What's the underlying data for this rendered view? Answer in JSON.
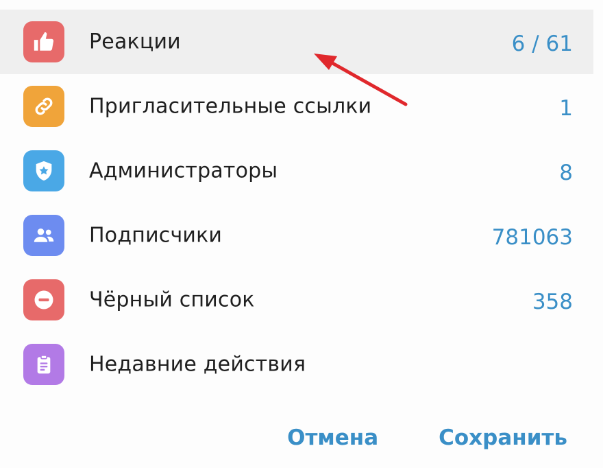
{
  "items": [
    {
      "label": "Реакции",
      "value": "6 / 61",
      "icon": "thumbs-up-icon",
      "color": "#e76a6a",
      "highlight": true
    },
    {
      "label": "Пригласительные ссылки",
      "value": "1",
      "icon": "link-icon",
      "color": "#f0a43a",
      "highlight": false
    },
    {
      "label": "Администраторы",
      "value": "8",
      "icon": "shield-star-icon",
      "color": "#4aa8e6",
      "highlight": false
    },
    {
      "label": "Подписчики",
      "value": "781063",
      "icon": "people-icon",
      "color": "#6d8cf0",
      "highlight": false
    },
    {
      "label": "Чёрный список",
      "value": "358",
      "icon": "minus-circle-icon",
      "color": "#e76a6a",
      "highlight": false
    },
    {
      "label": "Недавние действия",
      "value": "",
      "icon": "clipboard-icon",
      "color": "#b27ae6",
      "highlight": false
    }
  ],
  "footer": {
    "cancel_label": "Отмена",
    "save_label": "Сохранить"
  },
  "colors": {
    "accent": "#3a8fc7",
    "highlight_bg": "#efefef",
    "arrow": "#e0282c"
  }
}
